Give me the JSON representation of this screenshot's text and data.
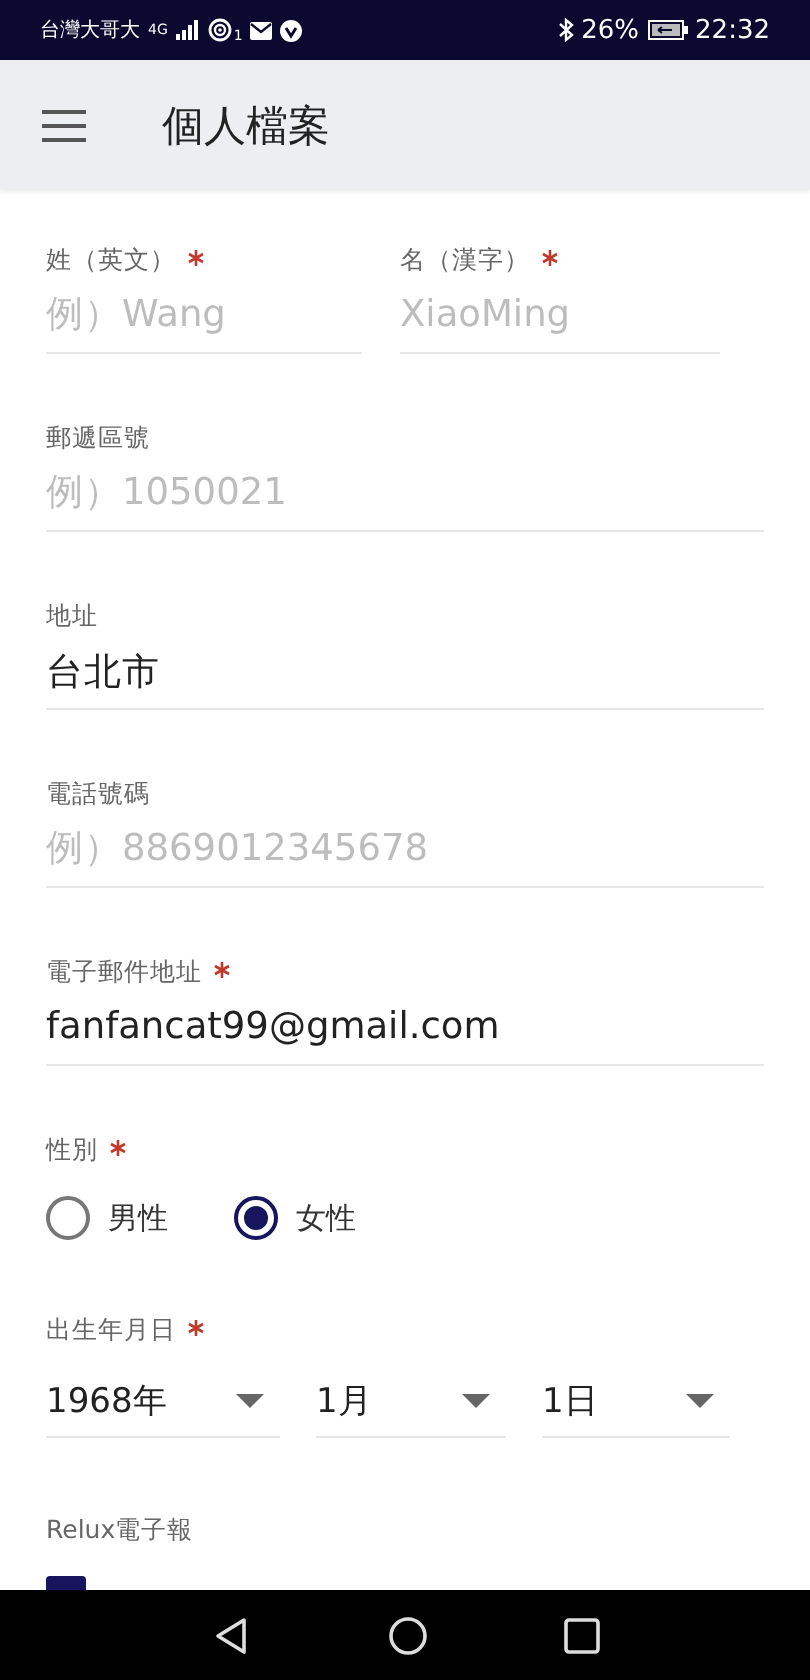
{
  "status_bar": {
    "carrier": "台灣大哥大",
    "network": "4G",
    "wifi_badge": "1",
    "battery": "26%",
    "time": "22:32"
  },
  "app_bar": {
    "title": "個人檔案"
  },
  "fields": [
    {
      "kind": "pair",
      "items": [
        {
          "label": "姓（英文）",
          "required": true,
          "placeholder": "例）Wang"
        },
        {
          "label": "名（漢字）",
          "required": true,
          "placeholder": "XiaoMing"
        }
      ]
    },
    {
      "kind": "text",
      "label": "郵遞區號",
      "required": false,
      "placeholder": "例）1050021"
    },
    {
      "kind": "text",
      "label": "地址",
      "required": false,
      "value": "台北市"
    },
    {
      "kind": "text",
      "label": "電話號碼",
      "required": false,
      "placeholder": "例）8869012345678"
    },
    {
      "kind": "text",
      "label": "電子郵件地址",
      "required": true,
      "value": "fanfancat99@gmail.com"
    }
  ],
  "gender": {
    "label": "性別",
    "required": true,
    "options": [
      {
        "label": "男性",
        "selected": false
      },
      {
        "label": "女性",
        "selected": true
      }
    ]
  },
  "birthday": {
    "label": "出生年月日",
    "required": true,
    "selects": [
      {
        "value": "1968年"
      },
      {
        "value": "1月"
      },
      {
        "value": "1日"
      }
    ]
  },
  "newsletter": {
    "label": "Relux電子報",
    "checked": true
  }
}
